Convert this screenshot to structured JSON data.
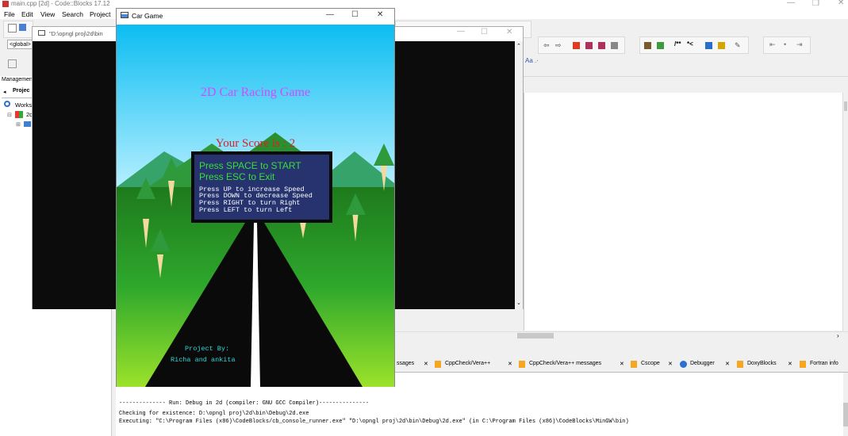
{
  "ide": {
    "title": "main.cpp [2d] - Code::Blocks 17.12",
    "menus": [
      "File",
      "Edit",
      "View",
      "Search",
      "Project"
    ],
    "global_combo": "<global>",
    "management_title": "Managemen",
    "projects_tab": "Projec",
    "workspace_label": "Works",
    "project_node": "2d",
    "log_tabs": [
      "ssages",
      "CppCheck/Vera++",
      "CppCheck/Vera++ messages",
      "Cscope",
      "Debugger",
      "DoxyBlocks",
      "Fortran info"
    ],
    "log_lines": [
      "-------------- Run: Debug in 2d (compiler: GNU GCC Compiler)---------------",
      "Checking for existence: D:\\opngl proj\\2d\\bin\\Debug\\2d.exe",
      "Executing: \"C:\\Program Files (x86)\\CodeBlocks/cb_console_runner.exe\" \"D:\\opngl proj\\2d\\bin\\Debug\\2d.exe\"  (in C:\\Program Files (x86)\\CodeBlocks\\MinGW\\bin)"
    ]
  },
  "console": {
    "title": "\"D:\\opngl proj\\2d\\bin"
  },
  "game_window": {
    "title": "Car Game",
    "heading": "2D Car Racing Game",
    "score": "Your Score is : 2",
    "instructions_big": [
      "Press SPACE to START",
      "Press ESC to Exit"
    ],
    "instructions_small": [
      "Press UP to increase Speed",
      "Press DOWN to decrease Speed",
      "Press RIGHT to turn Right",
      "Press LEFT to turn Left"
    ],
    "credits": [
      "Project By:",
      "Richa and ankita"
    ]
  },
  "colors": {
    "sky": "#15c3f3",
    "grass": "#2ea82c",
    "road": "#0a0a0a",
    "heading": "#d44bff",
    "score": "#d8222a",
    "instr_box": "#27336f",
    "instr_big": "#35e035",
    "credits": "#31d6d6"
  }
}
